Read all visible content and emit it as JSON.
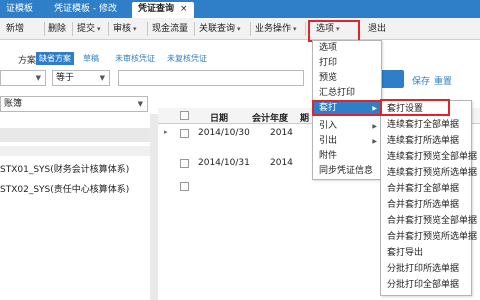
{
  "tabs": [
    {
      "label": "证模板"
    },
    {
      "label": "凭证模板 - 修改"
    },
    {
      "label": "凭证查询",
      "close": "×"
    }
  ],
  "toolbar": {
    "items": [
      "新增",
      "删除",
      "提交",
      "审核",
      "现金流量",
      "关联查询",
      "业务操作",
      "选项",
      "退出"
    ]
  },
  "filter": {
    "scheme_label": "方案:",
    "schemes": [
      "缺省方案",
      "草稿",
      "未审核凭证",
      "未复核凭证"
    ],
    "field_value": "",
    "operator": "等于",
    "ledger_suffix": "账簿",
    "save": "保存",
    "reset": "重置"
  },
  "left_rows": [
    "STX01_SYS(财务会计核算体系)",
    "STX02_SYS(责任中心核算体系)"
  ],
  "grid": {
    "headers": [
      "日期",
      "会计年度",
      "期"
    ],
    "rows": [
      {
        "date": "2014/10/30",
        "year": "2014"
      },
      {
        "date": "2014/10/31",
        "year": "2014"
      }
    ]
  },
  "options_menu": {
    "items": [
      "选项",
      "打印",
      "预览",
      "汇总打印",
      "套打",
      "引入",
      "引出",
      "附件",
      "同步凭证信息"
    ]
  },
  "submenu": {
    "items": [
      "套打设置",
      "连续套打全部单据",
      "连续套打所选单据",
      "连续套打预览全部单据",
      "连续套打预览所选单据",
      "合并套打全部单据",
      "合并套打所选单据",
      "合并套打预览全部单据",
      "合并套打预览所选单据",
      "套打导出",
      "分批打印所选单据",
      "分批打印全部单据"
    ]
  },
  "colors": {
    "accent": "#2f7fc8",
    "highlight_border": "#e0242b"
  }
}
